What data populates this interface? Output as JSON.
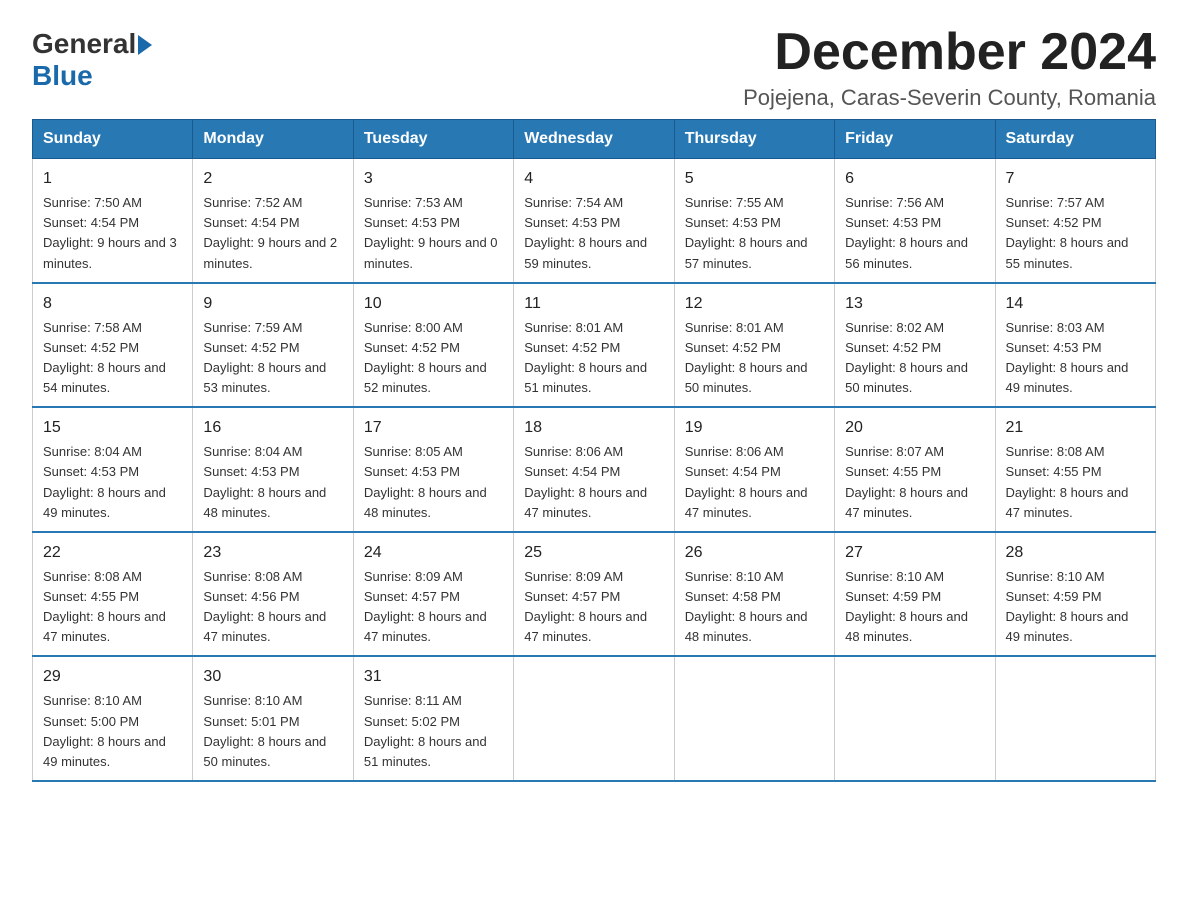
{
  "logo": {
    "general": "General",
    "blue": "Blue"
  },
  "title": "December 2024",
  "location": "Pojejena, Caras-Severin County, Romania",
  "headers": [
    "Sunday",
    "Monday",
    "Tuesday",
    "Wednesday",
    "Thursday",
    "Friday",
    "Saturday"
  ],
  "weeks": [
    [
      {
        "day": "1",
        "sunrise": "7:50 AM",
        "sunset": "4:54 PM",
        "daylight": "9 hours and 3 minutes."
      },
      {
        "day": "2",
        "sunrise": "7:52 AM",
        "sunset": "4:54 PM",
        "daylight": "9 hours and 2 minutes."
      },
      {
        "day": "3",
        "sunrise": "7:53 AM",
        "sunset": "4:53 PM",
        "daylight": "9 hours and 0 minutes."
      },
      {
        "day": "4",
        "sunrise": "7:54 AM",
        "sunset": "4:53 PM",
        "daylight": "8 hours and 59 minutes."
      },
      {
        "day": "5",
        "sunrise": "7:55 AM",
        "sunset": "4:53 PM",
        "daylight": "8 hours and 57 minutes."
      },
      {
        "day": "6",
        "sunrise": "7:56 AM",
        "sunset": "4:53 PM",
        "daylight": "8 hours and 56 minutes."
      },
      {
        "day": "7",
        "sunrise": "7:57 AM",
        "sunset": "4:52 PM",
        "daylight": "8 hours and 55 minutes."
      }
    ],
    [
      {
        "day": "8",
        "sunrise": "7:58 AM",
        "sunset": "4:52 PM",
        "daylight": "8 hours and 54 minutes."
      },
      {
        "day": "9",
        "sunrise": "7:59 AM",
        "sunset": "4:52 PM",
        "daylight": "8 hours and 53 minutes."
      },
      {
        "day": "10",
        "sunrise": "8:00 AM",
        "sunset": "4:52 PM",
        "daylight": "8 hours and 52 minutes."
      },
      {
        "day": "11",
        "sunrise": "8:01 AM",
        "sunset": "4:52 PM",
        "daylight": "8 hours and 51 minutes."
      },
      {
        "day": "12",
        "sunrise": "8:01 AM",
        "sunset": "4:52 PM",
        "daylight": "8 hours and 50 minutes."
      },
      {
        "day": "13",
        "sunrise": "8:02 AM",
        "sunset": "4:52 PM",
        "daylight": "8 hours and 50 minutes."
      },
      {
        "day": "14",
        "sunrise": "8:03 AM",
        "sunset": "4:53 PM",
        "daylight": "8 hours and 49 minutes."
      }
    ],
    [
      {
        "day": "15",
        "sunrise": "8:04 AM",
        "sunset": "4:53 PM",
        "daylight": "8 hours and 49 minutes."
      },
      {
        "day": "16",
        "sunrise": "8:04 AM",
        "sunset": "4:53 PM",
        "daylight": "8 hours and 48 minutes."
      },
      {
        "day": "17",
        "sunrise": "8:05 AM",
        "sunset": "4:53 PM",
        "daylight": "8 hours and 48 minutes."
      },
      {
        "day": "18",
        "sunrise": "8:06 AM",
        "sunset": "4:54 PM",
        "daylight": "8 hours and 47 minutes."
      },
      {
        "day": "19",
        "sunrise": "8:06 AM",
        "sunset": "4:54 PM",
        "daylight": "8 hours and 47 minutes."
      },
      {
        "day": "20",
        "sunrise": "8:07 AM",
        "sunset": "4:55 PM",
        "daylight": "8 hours and 47 minutes."
      },
      {
        "day": "21",
        "sunrise": "8:08 AM",
        "sunset": "4:55 PM",
        "daylight": "8 hours and 47 minutes."
      }
    ],
    [
      {
        "day": "22",
        "sunrise": "8:08 AM",
        "sunset": "4:55 PM",
        "daylight": "8 hours and 47 minutes."
      },
      {
        "day": "23",
        "sunrise": "8:08 AM",
        "sunset": "4:56 PM",
        "daylight": "8 hours and 47 minutes."
      },
      {
        "day": "24",
        "sunrise": "8:09 AM",
        "sunset": "4:57 PM",
        "daylight": "8 hours and 47 minutes."
      },
      {
        "day": "25",
        "sunrise": "8:09 AM",
        "sunset": "4:57 PM",
        "daylight": "8 hours and 47 minutes."
      },
      {
        "day": "26",
        "sunrise": "8:10 AM",
        "sunset": "4:58 PM",
        "daylight": "8 hours and 48 minutes."
      },
      {
        "day": "27",
        "sunrise": "8:10 AM",
        "sunset": "4:59 PM",
        "daylight": "8 hours and 48 minutes."
      },
      {
        "day": "28",
        "sunrise": "8:10 AM",
        "sunset": "4:59 PM",
        "daylight": "8 hours and 49 minutes."
      }
    ],
    [
      {
        "day": "29",
        "sunrise": "8:10 AM",
        "sunset": "5:00 PM",
        "daylight": "8 hours and 49 minutes."
      },
      {
        "day": "30",
        "sunrise": "8:10 AM",
        "sunset": "5:01 PM",
        "daylight": "8 hours and 50 minutes."
      },
      {
        "day": "31",
        "sunrise": "8:11 AM",
        "sunset": "5:02 PM",
        "daylight": "8 hours and 51 minutes."
      },
      null,
      null,
      null,
      null
    ]
  ]
}
